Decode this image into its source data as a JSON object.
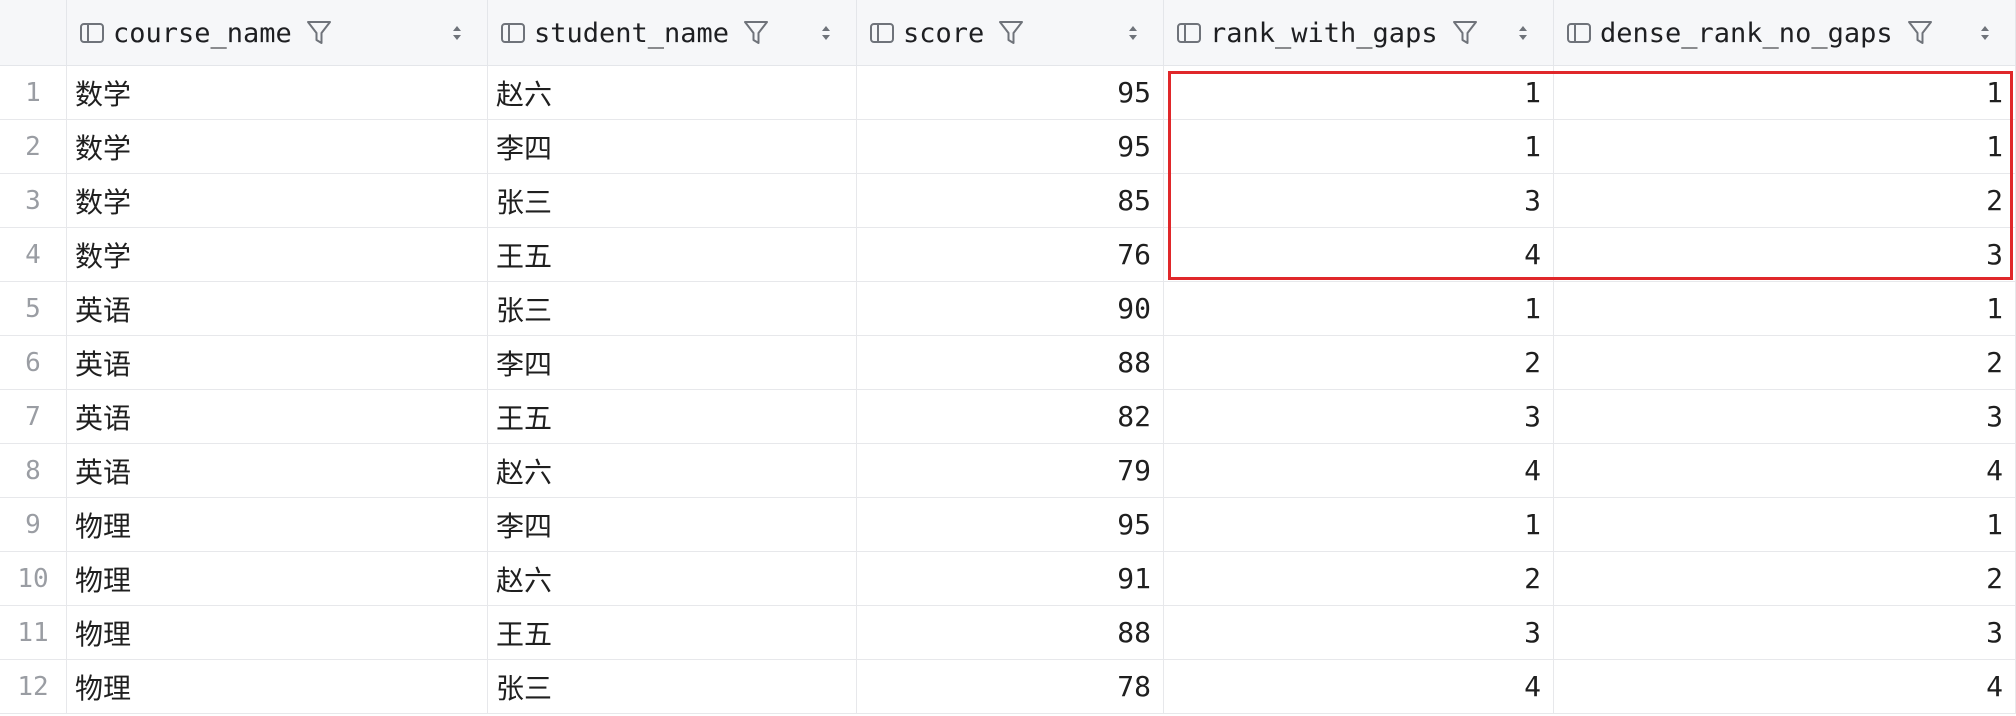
{
  "columns": [
    {
      "key": "course_name",
      "label": "course_name"
    },
    {
      "key": "student_name",
      "label": "student_name"
    },
    {
      "key": "score",
      "label": "score"
    },
    {
      "key": "rank_with_gaps",
      "label": "rank_with_gaps"
    },
    {
      "key": "dense_rank_no_gaps",
      "label": "dense_rank_no_gaps"
    }
  ],
  "rows": [
    {
      "n": "1",
      "course_name": "数学",
      "student_name": "赵六",
      "score": "95",
      "rank_with_gaps": "1",
      "dense_rank_no_gaps": "1"
    },
    {
      "n": "2",
      "course_name": "数学",
      "student_name": "李四",
      "score": "95",
      "rank_with_gaps": "1",
      "dense_rank_no_gaps": "1"
    },
    {
      "n": "3",
      "course_name": "数学",
      "student_name": "张三",
      "score": "85",
      "rank_with_gaps": "3",
      "dense_rank_no_gaps": "2"
    },
    {
      "n": "4",
      "course_name": "数学",
      "student_name": "王五",
      "score": "76",
      "rank_with_gaps": "4",
      "dense_rank_no_gaps": "3"
    },
    {
      "n": "5",
      "course_name": "英语",
      "student_name": "张三",
      "score": "90",
      "rank_with_gaps": "1",
      "dense_rank_no_gaps": "1"
    },
    {
      "n": "6",
      "course_name": "英语",
      "student_name": "李四",
      "score": "88",
      "rank_with_gaps": "2",
      "dense_rank_no_gaps": "2"
    },
    {
      "n": "7",
      "course_name": "英语",
      "student_name": "王五",
      "score": "82",
      "rank_with_gaps": "3",
      "dense_rank_no_gaps": "3"
    },
    {
      "n": "8",
      "course_name": "英语",
      "student_name": "赵六",
      "score": "79",
      "rank_with_gaps": "4",
      "dense_rank_no_gaps": "4"
    },
    {
      "n": "9",
      "course_name": "物理",
      "student_name": "李四",
      "score": "95",
      "rank_with_gaps": "1",
      "dense_rank_no_gaps": "1"
    },
    {
      "n": "10",
      "course_name": "物理",
      "student_name": "赵六",
      "score": "91",
      "rank_with_gaps": "2",
      "dense_rank_no_gaps": "2"
    },
    {
      "n": "11",
      "course_name": "物理",
      "student_name": "王五",
      "score": "88",
      "rank_with_gaps": "3",
      "dense_rank_no_gaps": "3"
    },
    {
      "n": "12",
      "course_name": "物理",
      "student_name": "张三",
      "score": "78",
      "rank_with_gaps": "4",
      "dense_rank_no_gaps": "4"
    }
  ],
  "colors": {
    "highlight_border": "#e0272a",
    "header_bg": "#f6f7f9"
  },
  "icons": {
    "column": "column-icon",
    "filter": "filter-icon",
    "sort": "sort-icon"
  }
}
